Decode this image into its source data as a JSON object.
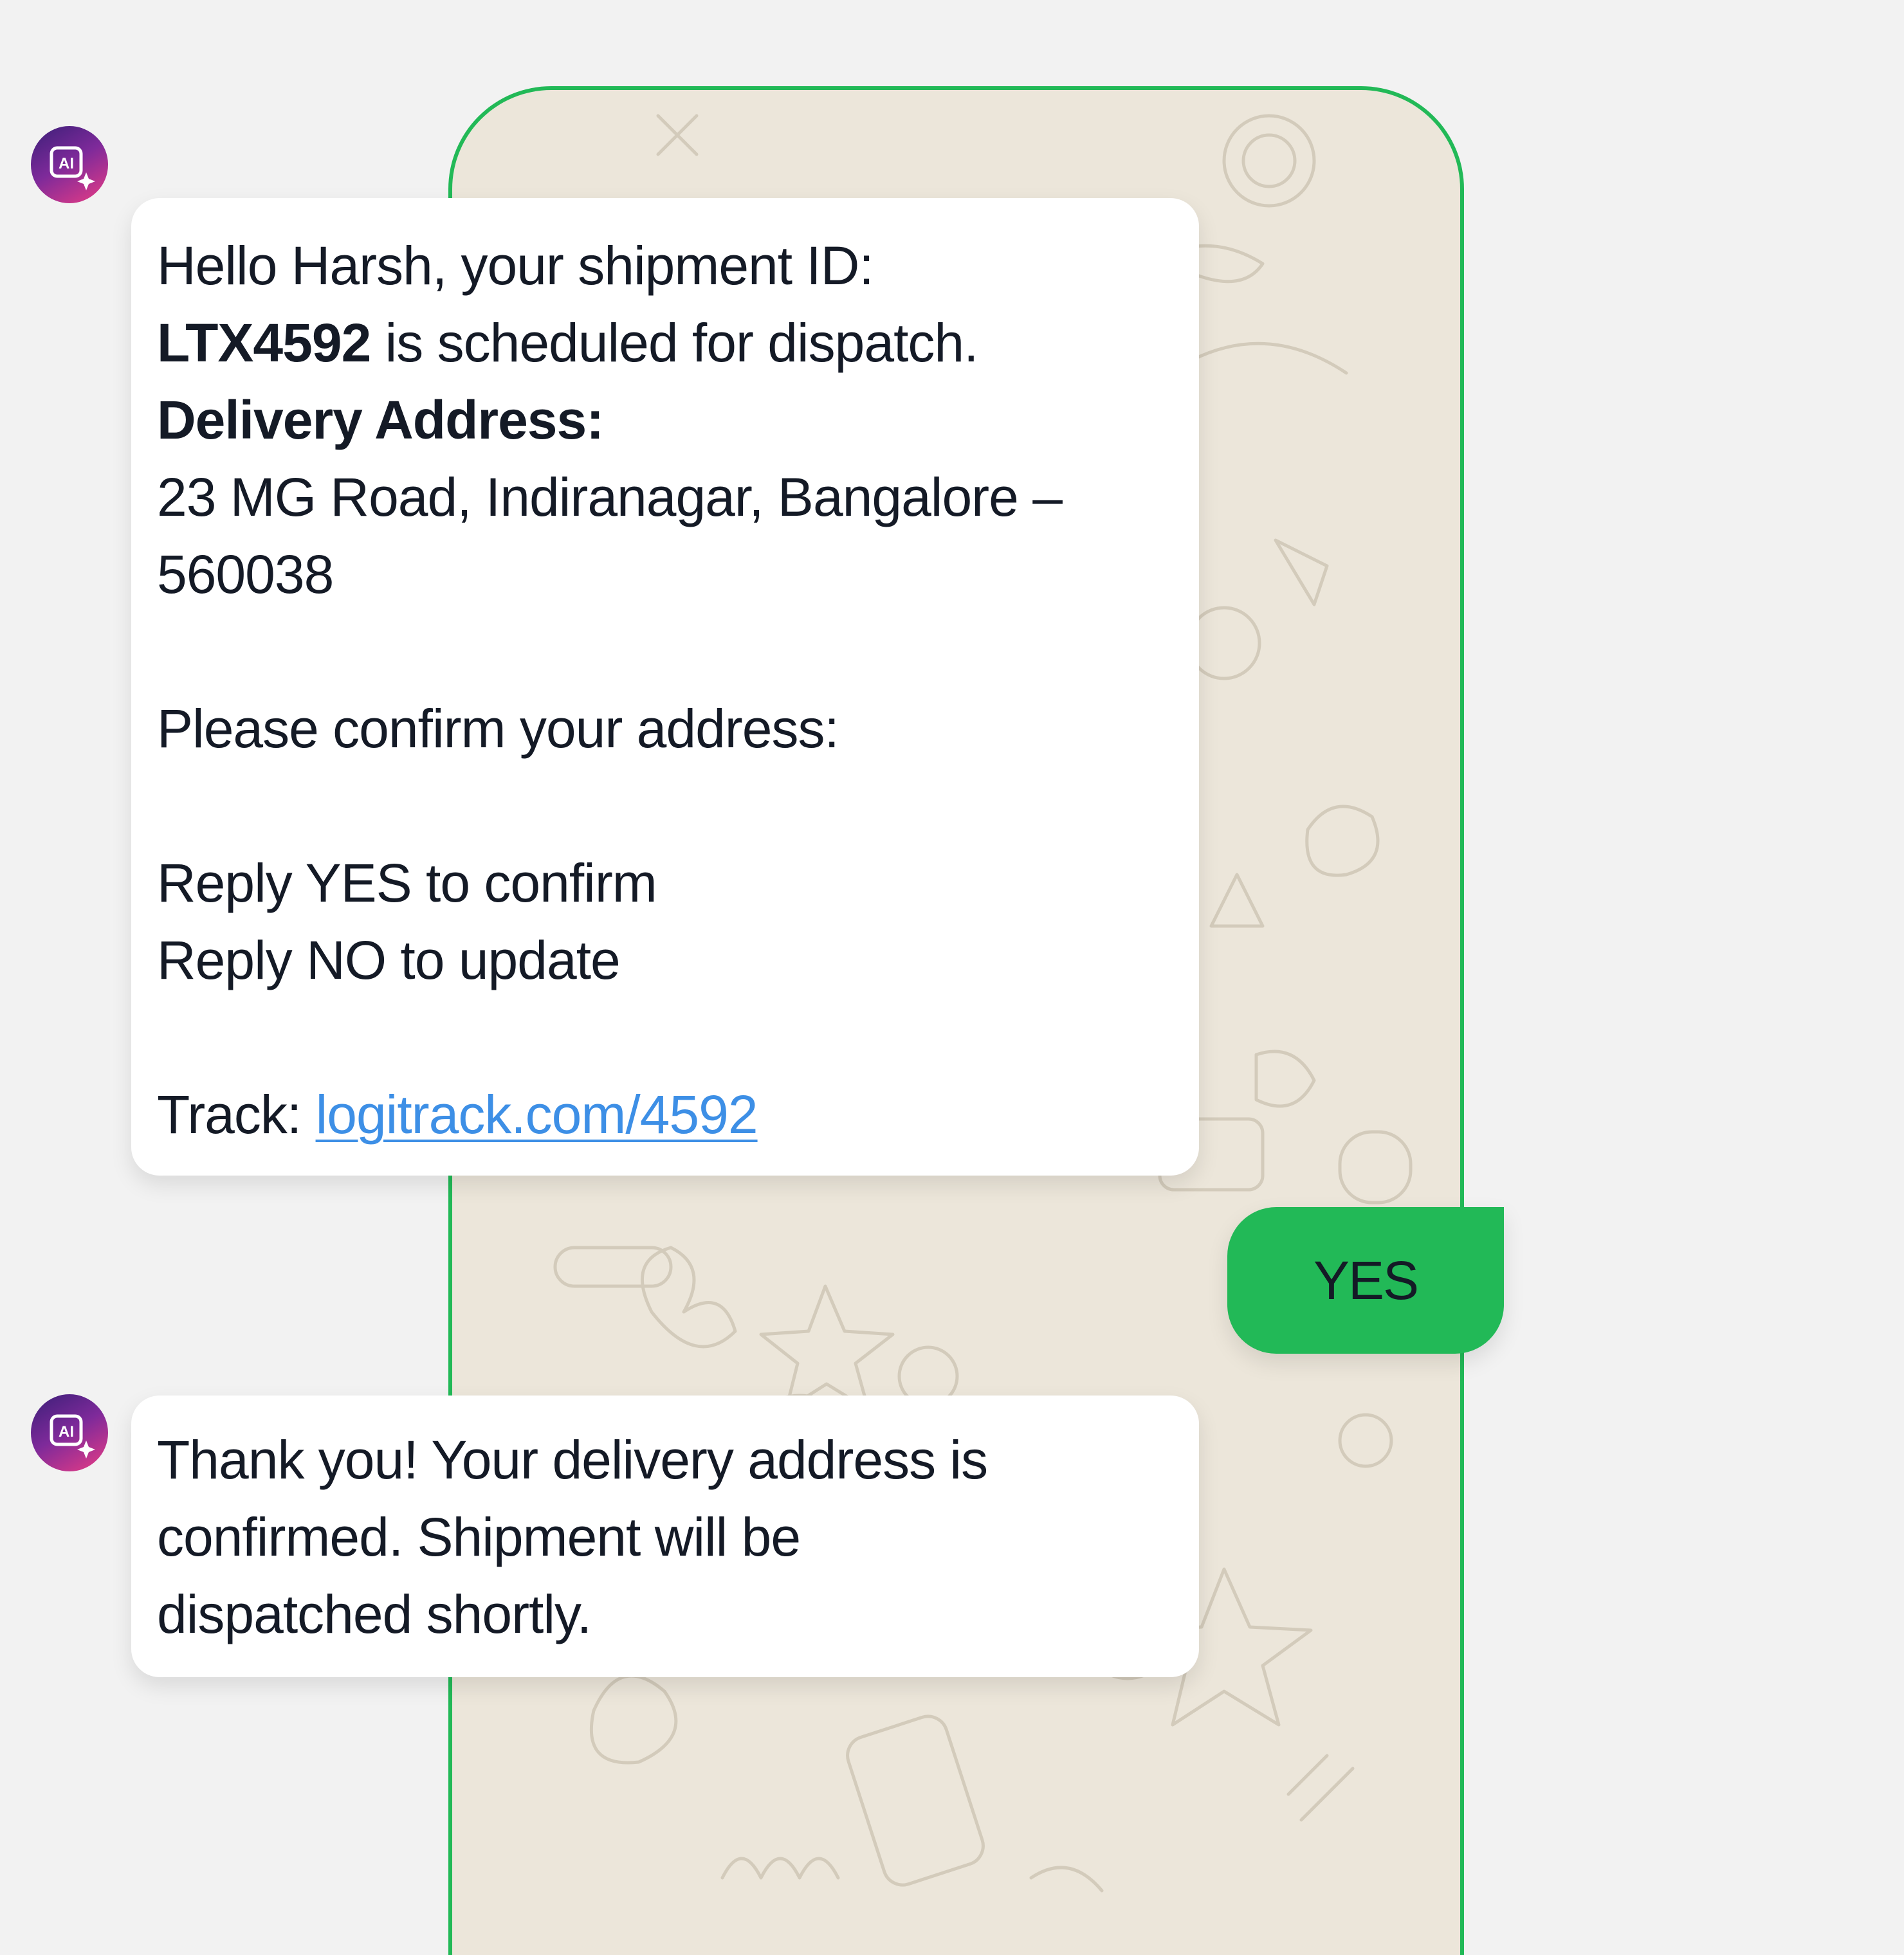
{
  "colors": {
    "accent_green": "#22b957",
    "chat_wallpaper": "#ece6da",
    "page_background": "#f2f2f2",
    "link": "#3d8fe6",
    "text": "#141a26"
  },
  "bot_avatar": {
    "icon": "ai-sparkle-icon",
    "label": "AI"
  },
  "messages": [
    {
      "sender": "bot",
      "lines": {
        "l1": "Hello Harsh, your shipment ID:",
        "shipment_id": "LTX4592",
        "l2_rest": " is scheduled for dispatch.",
        "address_heading": "Delivery Address:",
        "address_line1": "23 MG Road, Indiranagar, Bangalore –",
        "address_line2": "560038",
        "confirm_prompt": "Please confirm your address:",
        "reply_yes": "Reply YES to confirm",
        "reply_no": "Reply NO to update",
        "track_label": "Track: ",
        "track_link": "logitrack.com/4592"
      }
    },
    {
      "sender": "user",
      "text": "YES"
    },
    {
      "sender": "bot",
      "lines": {
        "l1": "Thank you! Your delivery address is",
        "l2": "confirmed. Shipment will be",
        "l3": "dispatched shortly."
      }
    }
  ]
}
